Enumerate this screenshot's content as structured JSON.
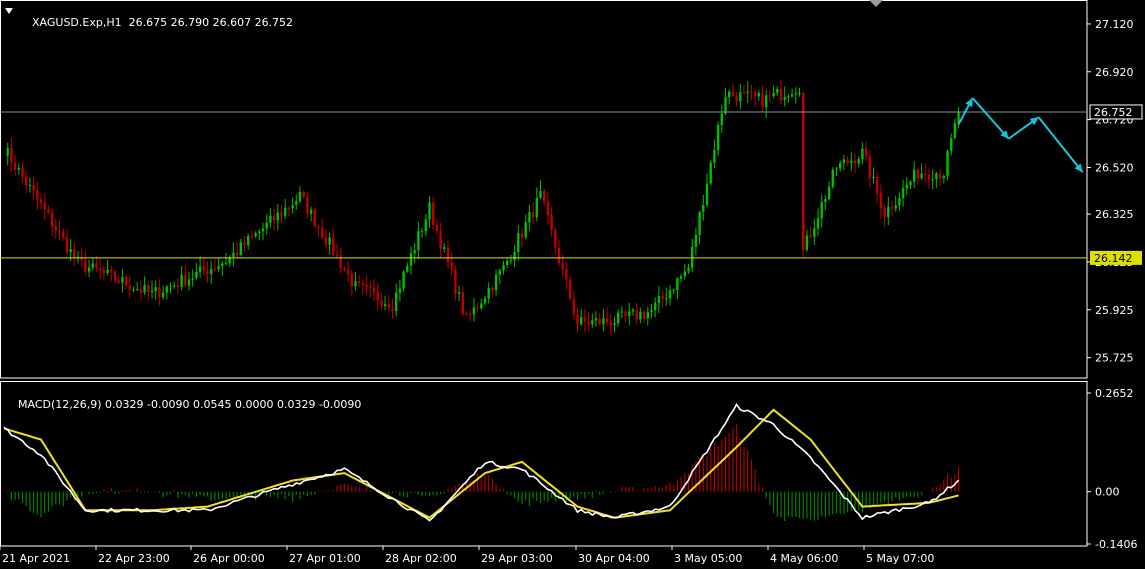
{
  "header": {
    "symbol": "XAGUSD.Exp,H1",
    "ohlc": "26.675 26.790 26.607 26.752"
  },
  "macd_header": {
    "label": "MACD(12,26,9)",
    "values": "0.0329 -0.0090 0.0545 0.0000 0.0329 -0.0090"
  },
  "price_axis": {
    "ticks": [
      "27.120",
      "26.920",
      "26.720",
      "26.520",
      "26.325",
      "26.125",
      "25.925",
      "25.725"
    ],
    "current_price": "26.752",
    "level_price": "26.142"
  },
  "macd_axis": {
    "ticks": [
      "0.2652",
      "0.00",
      "-0.1406"
    ]
  },
  "time_axis": {
    "labels": [
      "21 Apr 2021",
      "22 Apr 23:00",
      "26 Apr 00:00",
      "27 Apr 01:00",
      "28 Apr 02:00",
      "29 Apr 03:00",
      "30 Apr 04:00",
      "3 May 05:00",
      "4 May 06:00",
      "5 May 07:00"
    ]
  },
  "colors": {
    "background": "#000000",
    "bull_candle": "#00c000",
    "bear_candle": "#c00000",
    "level_line": "#e0e000",
    "current_line": "#8090a0",
    "forecast_arrow": "#18c4e0",
    "macd_line": "#ffffff",
    "signal_line": "#f0e020",
    "hist_positive": "#b00000",
    "hist_negative": "#008000"
  },
  "chart_data": {
    "type": "candlestick",
    "symbol": "XAGUSD.Exp",
    "timeframe": "H1",
    "y_range": [
      25.64,
      27.22
    ],
    "level_line": 26.142,
    "current_price": 26.752,
    "key_points": [
      {
        "bar": 0,
        "close": 26.6
      },
      {
        "bar": 20,
        "close": 26.12
      },
      {
        "bar": 40,
        "close": 25.99
      },
      {
        "bar": 60,
        "close": 26.13
      },
      {
        "bar": 80,
        "close": 26.4
      },
      {
        "bar": 95,
        "close": 26.02
      },
      {
        "bar": 105,
        "close": 25.95
      },
      {
        "bar": 115,
        "close": 26.35
      },
      {
        "bar": 125,
        "close": 25.88
      },
      {
        "bar": 135,
        "close": 26.1
      },
      {
        "bar": 145,
        "close": 26.4
      },
      {
        "bar": 155,
        "close": 25.87
      },
      {
        "bar": 165,
        "close": 25.88
      },
      {
        "bar": 175,
        "close": 25.92
      },
      {
        "bar": 185,
        "close": 26.1
      },
      {
        "bar": 195,
        "close": 26.83
      },
      {
        "bar": 205,
        "close": 26.8
      },
      {
        "bar": 215,
        "close": 26.86
      },
      {
        "bar": 216,
        "close": 26.17
      },
      {
        "bar": 225,
        "close": 26.52
      },
      {
        "bar": 232,
        "close": 26.58
      },
      {
        "bar": 238,
        "close": 26.33
      },
      {
        "bar": 247,
        "close": 26.5
      },
      {
        "bar": 254,
        "close": 26.5
      },
      {
        "bar": 258,
        "close": 26.752
      }
    ],
    "forecast_path": [
      26.7,
      26.81,
      26.64,
      26.73,
      26.5
    ],
    "macd": {
      "y_range": [
        -0.1406,
        0.2652
      ],
      "key_points": [
        {
          "bar": 0,
          "macd": 0.17,
          "signal": 0.17
        },
        {
          "bar": 10,
          "macd": 0.1,
          "signal": 0.14
        },
        {
          "bar": 22,
          "macd": -0.05,
          "signal": -0.05
        },
        {
          "bar": 40,
          "macd": -0.05,
          "signal": -0.05
        },
        {
          "bar": 55,
          "macd": -0.05,
          "signal": -0.04
        },
        {
          "bar": 78,
          "macd": 0.02,
          "signal": 0.03
        },
        {
          "bar": 92,
          "macd": 0.06,
          "signal": 0.05
        },
        {
          "bar": 115,
          "macd": -0.08,
          "signal": -0.07
        },
        {
          "bar": 130,
          "macd": 0.08,
          "signal": 0.05
        },
        {
          "bar": 140,
          "macd": 0.06,
          "signal": 0.08
        },
        {
          "bar": 155,
          "macd": -0.05,
          "signal": -0.04
        },
        {
          "bar": 165,
          "macd": -0.07,
          "signal": -0.07
        },
        {
          "bar": 180,
          "macd": -0.04,
          "signal": -0.05
        },
        {
          "bar": 198,
          "macd": 0.23,
          "signal": 0.12
        },
        {
          "bar": 208,
          "macd": 0.18,
          "signal": 0.22
        },
        {
          "bar": 218,
          "macd": 0.09,
          "signal": 0.14
        },
        {
          "bar": 232,
          "macd": -0.07,
          "signal": -0.04
        },
        {
          "bar": 250,
          "macd": -0.03,
          "signal": -0.03
        },
        {
          "bar": 258,
          "macd": 0.03,
          "signal": -0.01
        }
      ]
    }
  }
}
